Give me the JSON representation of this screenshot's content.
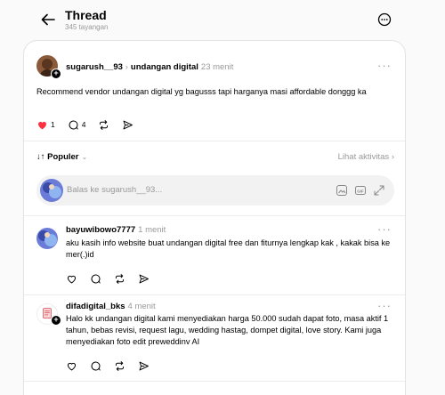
{
  "header": {
    "title": "Thread",
    "subtitle": "345 tayangan"
  },
  "main_post": {
    "username": "sugarush__93",
    "reply_to": "undangan digital",
    "time": "23 menit",
    "text": "Recommend vendor undangan digital yg bagusss tapi harganya masi affordable donggg ka",
    "likes": "1",
    "comments": "4",
    "accent": "#ff3040"
  },
  "sort": {
    "label": "Populer",
    "activity_link": "Lihat aktivitas"
  },
  "reply_box": {
    "placeholder": "Balas ke sugarush__93..."
  },
  "replies": [
    {
      "username": "bayuwibowo7777",
      "time": "1 menit",
      "text": "aku kasih info website buat undangan digital free dan fiturnya lengkap kak , kakak bisa ke mer(.)id"
    },
    {
      "username": "difadigital_bks",
      "time": "4 menit",
      "text": "Halo kk undangan digital kami menyediakan harga 50.000 sudah dapat foto, masa aktif 1 tahun, bebas revisi, request lagu, wedding hastag, dompet digital, love story. Kami juga menyediakan foto edit preweddinv AI"
    }
  ]
}
